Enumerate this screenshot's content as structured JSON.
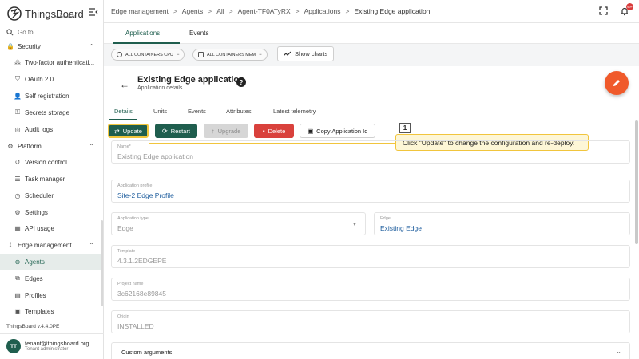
{
  "logo": {
    "name": "ThingsBoard",
    "edition": "Professional"
  },
  "search": {
    "placeholder": "Go to..."
  },
  "nav": [
    {
      "label": "Security",
      "icon": "lock-icon",
      "group": true,
      "chevron": "⌃"
    },
    {
      "label": "Two-factor authenticati...",
      "icon": "pin-icon"
    },
    {
      "label": "OAuth 2.0",
      "icon": "shield-icon"
    },
    {
      "label": "Self registration",
      "icon": "person-add-icon"
    },
    {
      "label": "Secrets storage",
      "icon": "key-icon"
    },
    {
      "label": "Audit logs",
      "icon": "audit-icon"
    },
    {
      "label": "Platform",
      "icon": "gear-icon",
      "group": true,
      "chevron": "⌃"
    },
    {
      "label": "Version control",
      "icon": "history-icon"
    },
    {
      "label": "Task manager",
      "icon": "tasks-icon"
    },
    {
      "label": "Scheduler",
      "icon": "clock-icon"
    },
    {
      "label": "Settings",
      "icon": "settings-icon"
    },
    {
      "label": "API usage",
      "icon": "api-icon"
    },
    {
      "label": "Edge management",
      "icon": "edge-icon",
      "group": true,
      "chevron": "⌃"
    },
    {
      "label": "Agents",
      "icon": "agents-icon",
      "active": true
    },
    {
      "label": "Edges",
      "icon": "edges-icon"
    },
    {
      "label": "Profiles",
      "icon": "profiles-icon"
    },
    {
      "label": "Templates",
      "icon": "templates-icon"
    }
  ],
  "version": "ThingsBoard v.4.4.0PE",
  "user": {
    "initials": "TT",
    "email": "tenant@thingsboard.org",
    "role": "Tenant administrator"
  },
  "breadcrumbs": [
    "Edge management",
    "Agents",
    "All",
    "Agent-TF0ATyRX",
    "Applications",
    "Existing Edge application"
  ],
  "breadcrumb_sep": ">",
  "notifications": {
    "badge": "99+"
  },
  "main_tabs": [
    "Applications",
    "Events"
  ],
  "filters": {
    "cpu": "ALL CONTAINERS CPU",
    "mem": "ALL CONTAINERS MEM",
    "show_charts": "Show charts"
  },
  "card": {
    "title": "Existing Edge application",
    "subtitle": "Application details",
    "help": "?"
  },
  "detail_tabs": [
    "Details",
    "Units",
    "Events",
    "Attributes",
    "Latest telemetry"
  ],
  "actions": {
    "update": "Update",
    "restart": "Restart",
    "upgrade": "Upgrade",
    "delete": "Delete",
    "copy": "Copy Application Id"
  },
  "callout": {
    "number": "1",
    "text": "Click \"Update\" to change the configuration and re-deploy."
  },
  "fields": {
    "name": {
      "label": "Name*",
      "value": "Existing Edge application"
    },
    "profile": {
      "label": "Application profile",
      "value": "Site-2 Edge Profile"
    },
    "type": {
      "label": "Application type",
      "value": "Edge"
    },
    "edge": {
      "label": "Edge",
      "value": "Existing Edge"
    },
    "template": {
      "label": "Template",
      "value": "4.3.1.2EDGEPE"
    },
    "project": {
      "label": "Project name",
      "value": "3c62168e89845"
    },
    "origin": {
      "label": "Origin",
      "value": "INSTALLED"
    }
  },
  "custom_args": "Custom arguments",
  "colors": {
    "primary": "#1f5e4e",
    "accent": "#f05a2b",
    "delete": "#d9413c",
    "callout": "#f1c53d"
  }
}
